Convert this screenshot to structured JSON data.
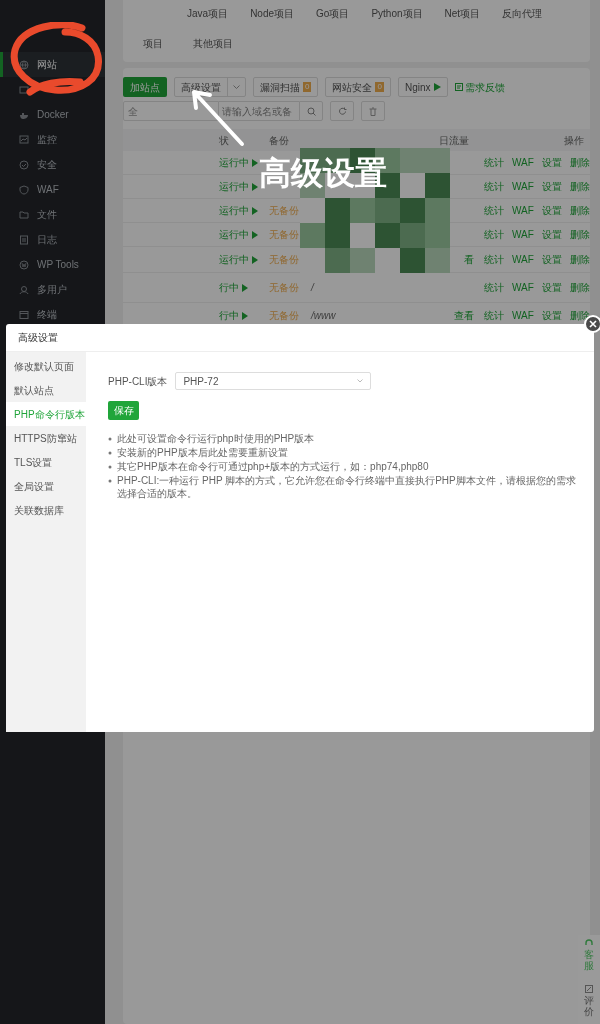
{
  "sidebar": {
    "items": [
      {
        "label": "网站",
        "selected": true
      },
      {
        "selected": false
      },
      {
        "label": "Docker",
        "selected": false
      },
      {
        "label": "监控",
        "selected": false
      },
      {
        "label": "安全",
        "selected": false
      },
      {
        "label": "WAF",
        "selected": false
      },
      {
        "label": "文件",
        "selected": false
      },
      {
        "label": "日志",
        "selected": false
      },
      {
        "label": "WP Tools",
        "selected": false
      },
      {
        "label": "多用户",
        "selected": false
      },
      {
        "label": "终端",
        "selected": false
      }
    ]
  },
  "project_tabs": {
    "row_1": [
      "Java项目",
      "Node项目",
      "Go项目",
      "Python项目",
      "Net项目",
      "反向代理"
    ],
    "row_2": [
      "项目",
      "其他项目"
    ]
  },
  "toolbar": {
    "add_site": "加站点",
    "advanced": "高级设置",
    "scan": {
      "label": "漏洞扫描",
      "count": "0"
    },
    "security": {
      "label": "网站安全",
      "count": "0"
    },
    "nginx": "Nginx",
    "feedback": "需求反馈"
  },
  "search": {
    "category": "全",
    "placeholder": "请输入域名或备"
  },
  "table": {
    "columns": [
      "状",
      "备份",
      "日流量",
      "操作"
    ],
    "rows": [
      {
        "status": "运行中",
        "running": true,
        "actions": [
          "统计",
          "WAF",
          "设置",
          "删除"
        ]
      },
      {
        "status": "运行中",
        "running": true,
        "actions": [
          "统计",
          "WAF",
          "设置",
          "删除"
        ]
      },
      {
        "status": "运行中",
        "running": true,
        "backup": "无备份",
        "actions": [
          "统计",
          "WAF",
          "设置",
          "删除"
        ]
      },
      {
        "status": "运行中",
        "running": true,
        "backup": "无备份",
        "actions": [
          "统计",
          "WAF",
          "设置",
          "删除"
        ]
      },
      {
        "status": "运行中",
        "running": true,
        "backup": "无备份",
        "traffic": "看",
        "actions": [
          "统计",
          "WAF",
          "设置",
          "删除"
        ]
      },
      {
        "status": "行中",
        "running": true,
        "backup": "无备份",
        "path": "/",
        "actions": [
          "统计",
          "WAF",
          "设置",
          "删除"
        ]
      },
      {
        "status": "行中",
        "running": true,
        "backup": "无备份",
        "path": "/www",
        "traffic": "查看",
        "actions": [
          "统计",
          "WAF",
          "设置",
          "删除"
        ]
      }
    ]
  },
  "annotation": {
    "label": "高级设置"
  },
  "dialog": {
    "title": "高级设置",
    "nav": [
      {
        "label": "修改默认页面",
        "selected": false
      },
      {
        "label": "默认站点",
        "selected": false
      },
      {
        "label": "PHP命令行版本",
        "selected": true
      },
      {
        "label": "HTTPS防窜站",
        "selected": false
      },
      {
        "label": "TLS设置",
        "selected": false
      },
      {
        "label": "全局设置",
        "selected": false
      },
      {
        "label": "关联数据库",
        "selected": false
      }
    ],
    "field_label": "PHP-CLI版本",
    "field_value": "PHP-72",
    "save": "保存",
    "notes": [
      "此处可设置命令行运行php时使用的PHP版本",
      "安装新的PHP版本后此处需要重新设置",
      "其它PHP版本在命令行可通过php+版本的方式运行，如：php74,php80",
      "PHP-CLI:一种运行 PHP 脚本的方式，它允许您在命令行终端中直接执行PHP脚本文件，请根据您的需求选择合适的版本。"
    ]
  },
  "side_float": [
    "客服",
    "评价"
  ]
}
